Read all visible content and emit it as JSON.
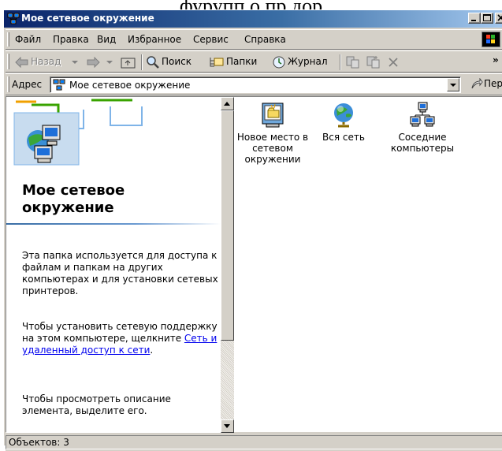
{
  "window": {
    "title": "Мое сетевое окружение"
  },
  "menu": {
    "items": [
      "Файл",
      "Правка",
      "Вид",
      "Избранное",
      "Сервис",
      "Справка"
    ]
  },
  "toolbar": {
    "back_label": "Назад",
    "search_label": "Поиск",
    "folders_label": "Папки",
    "history_label": "Журнал",
    "more_label": "»"
  },
  "address": {
    "label": "Адрес",
    "value": "Мое сетевое окружение",
    "go_label": "Переход"
  },
  "left_pane": {
    "heading": "Мое сетевое окружение",
    "para1": "Эта папка используется для доступа к файлам и папкам на других компьютерах и для установки сетевых принтеров.",
    "para2_prefix": "Чтобы установить сетевую поддержку на этом компьютере, щелкните ",
    "para2_link": "Сеть и удаленный доступ к сети",
    "para2_suffix": ".",
    "para3": "Чтобы просмотреть описание элемента, выделите его."
  },
  "items": [
    {
      "label": "Новое место в сетевом окружении",
      "icon": "add-network-place-icon"
    },
    {
      "label": "Вся сеть",
      "icon": "globe-icon"
    },
    {
      "label": "Соседние компьютеры",
      "icon": "computers-near-me-icon"
    }
  ],
  "status": {
    "text": "Объектов: 3"
  }
}
